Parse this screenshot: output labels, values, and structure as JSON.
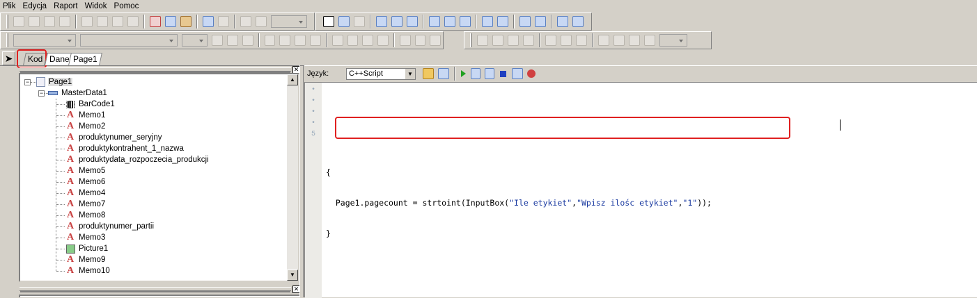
{
  "menu": [
    "Plik",
    "Edycja",
    "Raport",
    "Widok",
    "Pomoc"
  ],
  "tabs": {
    "code": "Kod",
    "data": "Dane",
    "page": "Page1"
  },
  "tree": {
    "root": "Page1",
    "band": "MasterData1",
    "children": [
      {
        "label": "BarCode1",
        "icon": "barcode-icon"
      },
      {
        "label": "Memo1",
        "icon": "text-icon"
      },
      {
        "label": "Memo2",
        "icon": "text-icon"
      },
      {
        "label": "produktynumer_seryjny",
        "icon": "text-icon"
      },
      {
        "label": "produktykontrahent_1_nazwa",
        "icon": "text-icon"
      },
      {
        "label": "produktydata_rozpoczecia_produkcji",
        "icon": "text-icon"
      },
      {
        "label": "Memo5",
        "icon": "text-icon"
      },
      {
        "label": "Memo6",
        "icon": "text-icon"
      },
      {
        "label": "Memo4",
        "icon": "text-icon"
      },
      {
        "label": "Memo7",
        "icon": "text-icon"
      },
      {
        "label": "Memo8",
        "icon": "text-icon"
      },
      {
        "label": "produktynumer_partii",
        "icon": "text-icon"
      },
      {
        "label": "Memo3",
        "icon": "text-icon"
      },
      {
        "label": "Picture1",
        "icon": "picture-icon"
      },
      {
        "label": "Memo9",
        "icon": "text-icon"
      },
      {
        "label": "Memo10",
        "icon": "text-icon"
      }
    ]
  },
  "code_toolbar": {
    "language_label": "Język:",
    "language_value": "C++Script"
  },
  "code": {
    "line_numbers": [
      "•",
      "•",
      "•",
      "•",
      "5"
    ],
    "lines": [
      "",
      "",
      "{",
      "  Page1.pagecount = strtoint(InputBox(\"Ile etykiet\",\"Wpisz ilośc etykiet\",\"1\"));",
      "}"
    ]
  },
  "colors": {
    "highlight": "#e02020",
    "string": "#1a3aa0"
  }
}
